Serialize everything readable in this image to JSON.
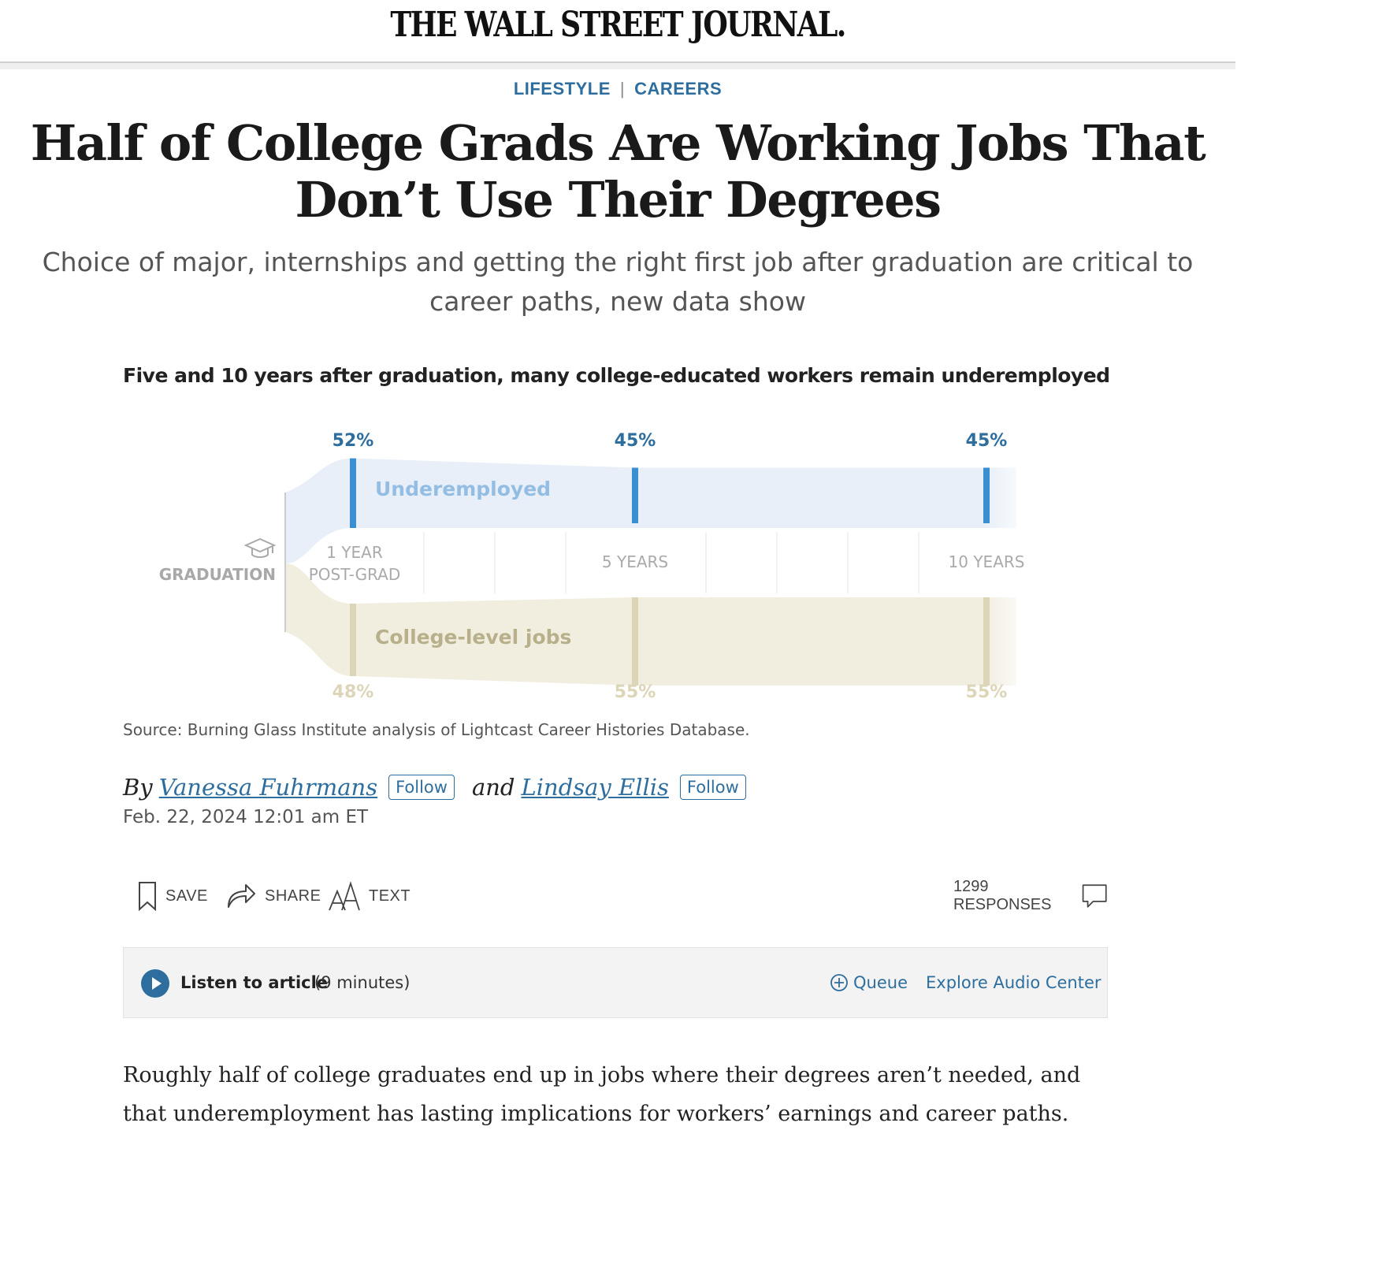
{
  "masthead": {
    "logo_text": "THE WALL STREET JOURNAL."
  },
  "flashline": {
    "section": "LIFESTYLE",
    "subsection": "CAREERS"
  },
  "article": {
    "headline": "Half of College Grads Are Working Jobs That Don’t Use Their Degrees",
    "dek": "Choice of major, internships and getting the right first job after graduation are critical to career paths, new data show",
    "byline_prefix": "By",
    "author1": "Vanessa Fuhrmans",
    "byline_and": "and",
    "author2": "Lindsay Ellis",
    "follow_label": "Follow",
    "timestamp": "Feb. 22, 2024 12:01 am ET",
    "body": "Roughly half of college graduates end up in jobs where their degrees aren’t needed, and that underemployment has lasting implications for workers’ earnings and career paths."
  },
  "chart_data": {
    "type": "area",
    "title": "Five and 10 years after graduation, many college-educated workers remain underemployed",
    "origin_label": "GRADUATION",
    "categories": [
      "1 YEAR POST-GRAD",
      "5 YEARS",
      "10 YEARS"
    ],
    "category_lines": [
      [
        "1 YEAR",
        "POST-GRAD"
      ],
      [
        "5 YEARS"
      ],
      [
        "10 YEARS"
      ]
    ],
    "x_years": [
      1,
      5,
      10
    ],
    "series": [
      {
        "name": "Underemployed",
        "values": [
          52,
          45,
          45
        ],
        "labels": [
          "52%",
          "45%",
          "45%"
        ],
        "color": "#3a8fd0",
        "fill": "#e8eff8",
        "label_color": "#2e6e9e",
        "name_color": "#93bde3"
      },
      {
        "name": "College-level jobs",
        "values": [
          48,
          55,
          55
        ],
        "labels": [
          "48%",
          "55%",
          "55%"
        ],
        "color": "#dcd5b8",
        "fill": "#f1eee0",
        "label_color": "#dcd5b8",
        "name_color": "#b8b08a"
      }
    ],
    "source": "Source: Burning Glass Institute analysis of Lightcast Career Histories Database."
  },
  "toolbar": {
    "save_label": "SAVE",
    "share_label": "SHARE",
    "text_label": "TEXT",
    "responses_label": "1299 RESPONSES"
  },
  "audio": {
    "listen_label": "Listen to article",
    "duration": "(9 minutes)",
    "queue_label": "Queue",
    "explore_label": "Explore Audio Center"
  },
  "colors": {
    "accent": "#2e6e9e",
    "text": "#222222",
    "muted": "#555555"
  },
  "icons": {
    "save": "bookmark-icon",
    "share": "share-arrow-icon",
    "text": "text-size-icon",
    "responses": "comment-bubble-icon",
    "play": "play-icon",
    "queue": "plus-circle-icon",
    "graduation": "graduation-cap-icon"
  }
}
